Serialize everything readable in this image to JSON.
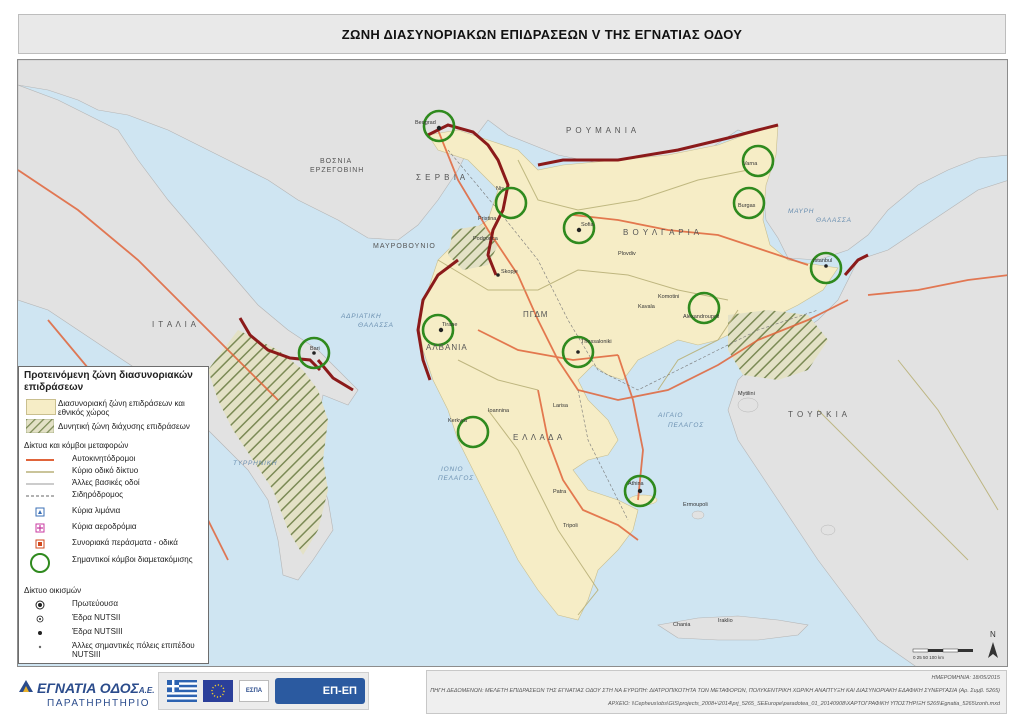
{
  "title": "ΖΩΝΗ ΔΙΑΣΥΝΟΡΙΑΚΩΝ ΕΠΙΔΡΑΣΕΩΝ V ΤΗΣ ΕΓΝΑΤΙΑΣ ΟΔΟΥ",
  "colors": {
    "sea": "#cfe5f2",
    "land_outside": "#e2e2e2",
    "impact_zone": "#f6edc6",
    "motorway": "#e0643a",
    "main_road": "#b9b178",
    "border_line": "#8b1a1a",
    "node_circle": "#2f8a1e"
  },
  "map": {
    "countries": {
      "romania": "Ρ Ο Υ Μ Α Ν Ι Α",
      "serbia": "Σ Ε Ρ Β Ι Α",
      "bosnia1": "ΒΟΣΝΙΑ",
      "bosnia2": "ΕΡΖΕΓΟΒΙΝΗ",
      "montenegro": "ΜΑΥΡΟΒΟΥΝΙΟ",
      "bulgaria": "Β Ο Υ Λ Γ Α Ρ Ι Α",
      "italy": "Ι Τ Α Λ Ι Α",
      "albania": "ΑΛΒΑΝΙΑ",
      "fyrom": "ΠΓΔΜ",
      "greece": "Ε Λ Λ Α Δ Α",
      "turkey": "Τ Ο Υ Ρ Κ Ι Α"
    },
    "seas": {
      "black1": "ΜΑΥΡΗ",
      "black2": "ΘΑΛΑΣΣΑ",
      "adriatic1": "ΑΔΡΙΑΤΙΚΗ",
      "adriatic2": "ΘΑΛΑΣΣΑ",
      "aegean1": "ΑΙΓΑΙΟ",
      "aegean2": "ΠΕΛΑΓΟΣ",
      "ionian1": "ΙΟΝΙΟ",
      "ionian2": "ΠΕΛΑΓΟΣ",
      "tyrrhenian": "ΤΥΡΡΗΝΙΚΗ"
    },
    "cities": {
      "beograd": "Beograd",
      "sofia": "Sofia",
      "skopje": "Skopje",
      "tirana": "Tirane",
      "bari": "Bari",
      "thessaloniki": "Thessaloniki",
      "athina": "Athina",
      "istanbul": "Istanbul",
      "podgorica": "Podgorica",
      "pristina": "Pristina",
      "kerkyra": "Kerkyra",
      "ioannina": "Ioannina",
      "larisa": "Larisa",
      "patra": "Patra",
      "tripoli": "Tripoli",
      "kavala": "Kavala",
      "komotini": "Komotini",
      "alexandroupoli": "Alexandroupoli",
      "plovdiv": "Plovdiv",
      "varna": "Varna",
      "burgas": "Burgas",
      "nis": "Nis",
      "mytilini": "Mytilini",
      "ermoupoli": "Ermoupoli",
      "irakleio": "Iraklio",
      "chania": "Chania"
    },
    "north_arrow": "N",
    "scale_text": "0 25 50 100 km"
  },
  "legend": {
    "title": "Προτεινόμενη ζώνη διασυνοριακών επιδράσεων",
    "zone_label": "Διασυνοριακή ζώνη επιδράσεων και εθνικός χώρος",
    "potential_label": "Δυνητική ζώνη διάχυσης επιδράσεων",
    "networks_title": "Δίκτυα και κόμβοι μεταφορών",
    "motorways": "Αυτοκινητόδρομοι",
    "main_roads": "Κύριο οδικό δίκτυο",
    "other_roads": "Άλλες βασικές οδοί",
    "railway": "Σιδηρόδρομος",
    "ports": "Κύρια λιμάνια",
    "airports": "Κύρια αεροδρόμια",
    "border_crossings": "Συνοριακά περάσματα - οδικά",
    "hubs": "Σημαντικοί κόμβοι διαμετακόμισης",
    "settlements_title": "Δίκτυο οικισμών",
    "capital": "Πρωτεύουσα",
    "nuts2": "Έδρα NUTSII",
    "nuts3": "Έδρα NUTSIII",
    "other_towns": "Άλλες σημαντικές πόλεις επιπέδου NUTSIII"
  },
  "footer": {
    "logo": "ΕΓΝΑΤΙΑ ΟΔΟΣ",
    "logo_suffix": "Α.Ε.",
    "observatory": "ΠΑΡΑΤΗΡΗΤΗΡΙΟ",
    "espa": "ΕΣΠΑ",
    "epep": "ΕΠ-ΕΠ",
    "date_line": "ΗΜΕΡΟΜΗΝΙΑ: 18/05/2015",
    "source_line": "ΠΗΓΗ ΔΕΔΟΜΕΝΩΝ: ΜΕΛΕΤΗ ΕΠΙΔΡΑΣΕΩΝ ΤΗΣ ΕΓΝΑΤΙΑΣ ΟΔΟΥ ΣΤΗ ΝΑ ΕΥΡΩΠΗ: ΔΙΑΤΡΟΠΙΚΟΤΗΤΑ ΤΩΝ ΜΕΤΑΦΟΡΩΝ, ΠΟΛΥΚΕΝΤΡΙΚΗ ΧΩΡΙΚΗ ΑΝΑΠΤΥΞΗ ΚΑΙ ΔΙΑΣΥΝΟΡΙΑΚΗ ΕΔΑΦΙΚΗ ΣΥΝΕΡΓΑΣΙΑ (Αρ. Συμβ. 5265)",
    "file_line": "ΑΡΧΕΙΟ: \\\\Cepheus\\obs\\GIS\\projects_2008+\\2014\\prj_5265_SEEurope\\paradotea_01_20140908\\ΧΑΡΤΟΓΡΑΦΙΚΗ ΥΠΟΣΤΗΡΙΞΗ 5265\\Egnatia_5265\\zonh.mxd"
  }
}
